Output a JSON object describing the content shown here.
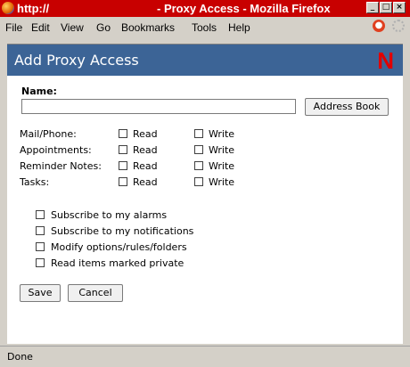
{
  "window": {
    "url_title": "http://",
    "page_title": "- Proxy Access - Mozilla Firefox"
  },
  "menu": [
    "File",
    "Edit",
    "View",
    "Go",
    "Bookmarks",
    "Tools",
    "Help"
  ],
  "header": {
    "title": "Add Proxy Access",
    "logo": "N"
  },
  "form": {
    "name_label": "Name:",
    "name_value": "",
    "address_book_label": "Address Book",
    "rights_rows": [
      {
        "label": "Mail/Phone:",
        "read": "Read",
        "write": "Write"
      },
      {
        "label": "Appointments:",
        "read": "Read",
        "write": "Write"
      },
      {
        "label": "Reminder Notes:",
        "read": "Read",
        "write": "Write"
      },
      {
        "label": "Tasks:",
        "read": "Read",
        "write": "Write"
      }
    ],
    "options": [
      "Subscribe to my alarms",
      "Subscribe to my notifications",
      "Modify options/rules/folders",
      "Read items marked private"
    ],
    "save_label": "Save",
    "cancel_label": "Cancel"
  },
  "status": {
    "text": "Done"
  }
}
